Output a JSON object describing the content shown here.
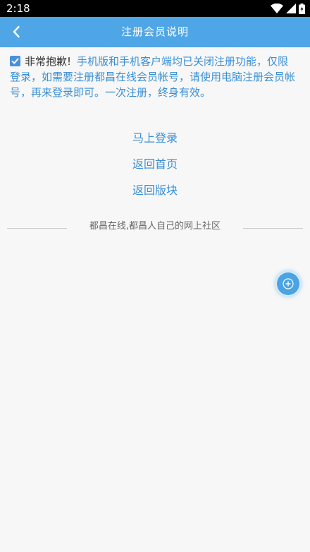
{
  "status_bar": {
    "time": "2:18"
  },
  "nav": {
    "title": "注册会员说明"
  },
  "notice": {
    "head": "非常抱歉!",
    "body": "手机版和手机客户端均已关闭注册功能，仅限登录，如需要注册都昌在线会员帐号，请使用电脑注册会员帐号，再来登录即可。一次注册，终身有效。"
  },
  "links": {
    "login": "马上登录",
    "home": "返回首页",
    "board": "返回版块"
  },
  "footer": {
    "text": "都昌在线,都昌人自己的网上社区"
  },
  "colors": {
    "accent": "#4fa6e6",
    "link": "#3a8fd6"
  }
}
